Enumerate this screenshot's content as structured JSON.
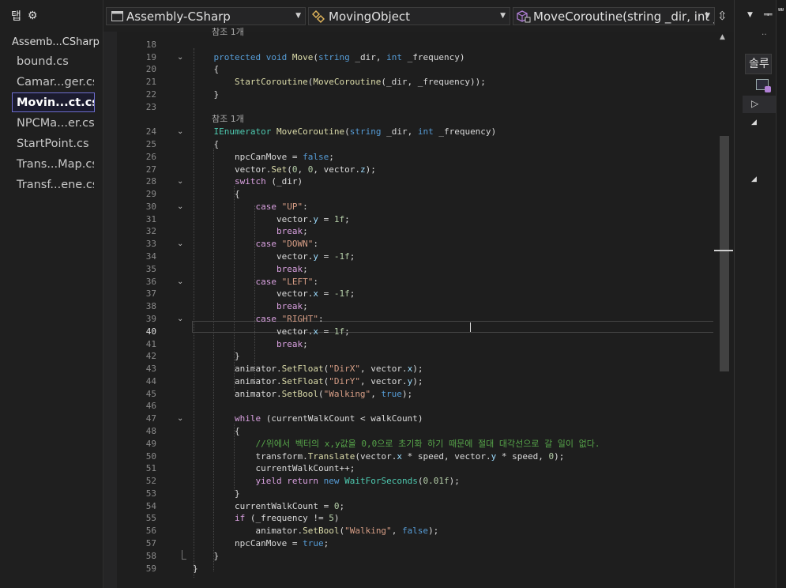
{
  "tab_panel": {
    "title": "탭",
    "settings_icon": "gear-icon",
    "project": "Assemb...CSharp",
    "files": [
      {
        "label": "bound.cs",
        "active": false
      },
      {
        "label": "Camar...ger.cs",
        "active": false
      },
      {
        "label": "Movin...ct.cs",
        "active": true
      },
      {
        "label": "NPCMa...er.cs",
        "active": false
      },
      {
        "label": "StartPoint.cs",
        "active": false
      },
      {
        "label": "Trans...Map.cs",
        "active": false
      },
      {
        "label": "Transf...ene.cs",
        "active": false
      }
    ]
  },
  "nav_bar": {
    "project": "Assembly-CSharp",
    "class": "MovingObject",
    "member": "MoveCoroutine(string _dir, int _"
  },
  "right_panel": {
    "tab_label": "솔루",
    "top_text": "ᄈ"
  },
  "codelens_text": "참조 1개",
  "current_line": 40,
  "lines": [
    {
      "n": 18,
      "lens": true,
      "code": []
    },
    {
      "n": 19,
      "fold": true,
      "code": [
        [
          "    ",
          ""
        ],
        [
          "protected",
          "kw"
        ],
        [
          " ",
          ""
        ],
        [
          "void",
          "kw"
        ],
        [
          " ",
          ""
        ],
        [
          "Move",
          "mt"
        ],
        [
          "(",
          ""
        ],
        [
          "string",
          "kw"
        ],
        [
          " ",
          ""
        ],
        [
          "_dir",
          "vr"
        ],
        [
          ", ",
          ""
        ],
        [
          "int",
          "kw"
        ],
        [
          " ",
          ""
        ],
        [
          "_frequency",
          "vr"
        ],
        [
          ")",
          ""
        ]
      ]
    },
    {
      "n": 20,
      "code": [
        [
          "    {",
          ""
        ]
      ]
    },
    {
      "n": 21,
      "code": [
        [
          "        ",
          ""
        ],
        [
          "StartCoroutine",
          "mt"
        ],
        [
          "(",
          ""
        ],
        [
          "MoveCoroutine",
          "mt"
        ],
        [
          "(",
          ""
        ],
        [
          "_dir",
          "vr"
        ],
        [
          ", ",
          ""
        ],
        [
          "_frequency",
          "vr"
        ],
        [
          "));",
          ""
        ]
      ]
    },
    {
      "n": 22,
      "code": [
        [
          "    }",
          ""
        ]
      ]
    },
    {
      "n": 23,
      "code": []
    },
    {
      "n": 24,
      "lens": true,
      "fold": true,
      "code": [
        [
          "    ",
          ""
        ],
        [
          "IEnumerator",
          "ty"
        ],
        [
          " ",
          ""
        ],
        [
          "MoveCoroutine",
          "mt"
        ],
        [
          "(",
          ""
        ],
        [
          "string",
          "kw"
        ],
        [
          " ",
          ""
        ],
        [
          "_dir",
          "vr"
        ],
        [
          ", ",
          ""
        ],
        [
          "int",
          "kw"
        ],
        [
          " ",
          ""
        ],
        [
          "_frequency",
          "vr"
        ],
        [
          ")",
          ""
        ]
      ]
    },
    {
      "n": 25,
      "code": [
        [
          "    {",
          ""
        ]
      ]
    },
    {
      "n": 26,
      "code": [
        [
          "        ",
          ""
        ],
        [
          "npcCanMove",
          "vr"
        ],
        [
          " = ",
          ""
        ],
        [
          "false",
          "kw"
        ],
        [
          ";",
          ""
        ]
      ]
    },
    {
      "n": 27,
      "code": [
        [
          "        ",
          ""
        ],
        [
          "vector",
          "vr"
        ],
        [
          ".",
          ""
        ],
        [
          "Set",
          "mt"
        ],
        [
          "(",
          ""
        ],
        [
          "0",
          "nu"
        ],
        [
          ", ",
          ""
        ],
        [
          "0",
          "nu"
        ],
        [
          ", ",
          ""
        ],
        [
          "vector",
          "vr"
        ],
        [
          ".",
          ""
        ],
        [
          "z",
          "pr"
        ],
        [
          ");",
          ""
        ]
      ]
    },
    {
      "n": 28,
      "fold": true,
      "code": [
        [
          "        ",
          ""
        ],
        [
          "switch",
          "fl"
        ],
        [
          " (",
          ""
        ],
        [
          "_dir",
          "vr"
        ],
        [
          ")",
          ""
        ]
      ]
    },
    {
      "n": 29,
      "code": [
        [
          "        {",
          ""
        ]
      ]
    },
    {
      "n": 30,
      "fold": true,
      "code": [
        [
          "            ",
          ""
        ],
        [
          "case",
          "fl"
        ],
        [
          " ",
          ""
        ],
        [
          "\"UP\"",
          "st"
        ],
        [
          ":",
          ""
        ]
      ]
    },
    {
      "n": 31,
      "code": [
        [
          "                ",
          ""
        ],
        [
          "vector",
          "vr"
        ],
        [
          ".",
          ""
        ],
        [
          "y",
          "pr"
        ],
        [
          " = ",
          ""
        ],
        [
          "1f",
          "nu"
        ],
        [
          ";",
          ""
        ]
      ]
    },
    {
      "n": 32,
      "code": [
        [
          "                ",
          ""
        ],
        [
          "break",
          "fl"
        ],
        [
          ";",
          ""
        ]
      ]
    },
    {
      "n": 33,
      "fold": true,
      "code": [
        [
          "            ",
          ""
        ],
        [
          "case",
          "fl"
        ],
        [
          " ",
          ""
        ],
        [
          "\"DOWN\"",
          "st"
        ],
        [
          ":",
          ""
        ]
      ]
    },
    {
      "n": 34,
      "code": [
        [
          "                ",
          ""
        ],
        [
          "vector",
          "vr"
        ],
        [
          ".",
          ""
        ],
        [
          "y",
          "pr"
        ],
        [
          " = ",
          ""
        ],
        [
          "-1f",
          "nu"
        ],
        [
          ";",
          ""
        ]
      ]
    },
    {
      "n": 35,
      "code": [
        [
          "                ",
          ""
        ],
        [
          "break",
          "fl"
        ],
        [
          ";",
          ""
        ]
      ]
    },
    {
      "n": 36,
      "fold": true,
      "code": [
        [
          "            ",
          ""
        ],
        [
          "case",
          "fl"
        ],
        [
          " ",
          ""
        ],
        [
          "\"LEFT\"",
          "st"
        ],
        [
          ":",
          ""
        ]
      ]
    },
    {
      "n": 37,
      "code": [
        [
          "                ",
          ""
        ],
        [
          "vector",
          "vr"
        ],
        [
          ".",
          ""
        ],
        [
          "x",
          "pr"
        ],
        [
          " = ",
          ""
        ],
        [
          "-1f",
          "nu"
        ],
        [
          ";",
          ""
        ]
      ]
    },
    {
      "n": 38,
      "code": [
        [
          "                ",
          ""
        ],
        [
          "break",
          "fl"
        ],
        [
          ";",
          ""
        ]
      ]
    },
    {
      "n": 39,
      "fold": true,
      "code": [
        [
          "            ",
          ""
        ],
        [
          "case",
          "fl"
        ],
        [
          " ",
          ""
        ],
        [
          "\"RIGHT\"",
          "st"
        ],
        [
          ":",
          ""
        ]
      ]
    },
    {
      "n": 40,
      "code": [
        [
          "                ",
          ""
        ],
        [
          "vector",
          "vr"
        ],
        [
          ".",
          ""
        ],
        [
          "x",
          "pr"
        ],
        [
          " = ",
          ""
        ],
        [
          "1f",
          "nu"
        ],
        [
          ";",
          ""
        ]
      ]
    },
    {
      "n": 41,
      "code": [
        [
          "                ",
          ""
        ],
        [
          "break",
          "fl"
        ],
        [
          ";",
          ""
        ]
      ]
    },
    {
      "n": 42,
      "code": [
        [
          "        }",
          ""
        ]
      ]
    },
    {
      "n": 43,
      "code": [
        [
          "        ",
          ""
        ],
        [
          "animator",
          "vr"
        ],
        [
          ".",
          ""
        ],
        [
          "SetFloat",
          "mt"
        ],
        [
          "(",
          ""
        ],
        [
          "\"DirX\"",
          "st"
        ],
        [
          ", ",
          ""
        ],
        [
          "vector",
          "vr"
        ],
        [
          ".",
          ""
        ],
        [
          "x",
          "pr"
        ],
        [
          ");",
          ""
        ]
      ]
    },
    {
      "n": 44,
      "code": [
        [
          "        ",
          ""
        ],
        [
          "animator",
          "vr"
        ],
        [
          ".",
          ""
        ],
        [
          "SetFloat",
          "mt"
        ],
        [
          "(",
          ""
        ],
        [
          "\"DirY\"",
          "st"
        ],
        [
          ", ",
          ""
        ],
        [
          "vector",
          "vr"
        ],
        [
          ".",
          ""
        ],
        [
          "y",
          "pr"
        ],
        [
          ");",
          ""
        ]
      ]
    },
    {
      "n": 45,
      "code": [
        [
          "        ",
          ""
        ],
        [
          "animator",
          "vr"
        ],
        [
          ".",
          ""
        ],
        [
          "SetBool",
          "mt"
        ],
        [
          "(",
          ""
        ],
        [
          "\"Walking\"",
          "st"
        ],
        [
          ", ",
          ""
        ],
        [
          "true",
          "kw"
        ],
        [
          ");",
          ""
        ]
      ]
    },
    {
      "n": 46,
      "code": []
    },
    {
      "n": 47,
      "fold": true,
      "code": [
        [
          "        ",
          ""
        ],
        [
          "while",
          "fl"
        ],
        [
          " (",
          ""
        ],
        [
          "currentWalkCount",
          "vr"
        ],
        [
          " < ",
          ""
        ],
        [
          "walkCount",
          "vr"
        ],
        [
          ")",
          ""
        ]
      ]
    },
    {
      "n": 48,
      "code": [
        [
          "        {",
          ""
        ]
      ]
    },
    {
      "n": 49,
      "code": [
        [
          "            ",
          ""
        ],
        [
          "//위에서 벡터의 x,y값을 0,0으로 초기화 하기 때문에 절대 대각선으로 갈 일이 없다.",
          "cm"
        ]
      ]
    },
    {
      "n": 50,
      "code": [
        [
          "            ",
          ""
        ],
        [
          "transform",
          "vr"
        ],
        [
          ".",
          ""
        ],
        [
          "Translate",
          "mt"
        ],
        [
          "(",
          ""
        ],
        [
          "vector",
          "vr"
        ],
        [
          ".",
          ""
        ],
        [
          "x",
          "pr"
        ],
        [
          " * ",
          ""
        ],
        [
          "speed",
          "vr"
        ],
        [
          ", ",
          ""
        ],
        [
          "vector",
          "vr"
        ],
        [
          ".",
          ""
        ],
        [
          "y",
          "pr"
        ],
        [
          " * ",
          ""
        ],
        [
          "speed",
          "vr"
        ],
        [
          ", ",
          ""
        ],
        [
          "0",
          "nu"
        ],
        [
          ");",
          ""
        ]
      ]
    },
    {
      "n": 51,
      "code": [
        [
          "            ",
          ""
        ],
        [
          "currentWalkCount",
          "vr"
        ],
        [
          "++;",
          ""
        ]
      ]
    },
    {
      "n": 52,
      "code": [
        [
          "            ",
          ""
        ],
        [
          "yield",
          "fl"
        ],
        [
          " ",
          ""
        ],
        [
          "return",
          "fl"
        ],
        [
          " ",
          ""
        ],
        [
          "new",
          "kw"
        ],
        [
          " ",
          ""
        ],
        [
          "WaitForSeconds",
          "ty"
        ],
        [
          "(",
          ""
        ],
        [
          "0.01f",
          "nu"
        ],
        [
          ");",
          ""
        ]
      ]
    },
    {
      "n": 53,
      "code": [
        [
          "        }",
          ""
        ]
      ]
    },
    {
      "n": 54,
      "code": [
        [
          "        ",
          ""
        ],
        [
          "currentWalkCount",
          "vr"
        ],
        [
          " = ",
          ""
        ],
        [
          "0",
          "nu"
        ],
        [
          ";",
          ""
        ]
      ]
    },
    {
      "n": 55,
      "code": [
        [
          "        ",
          ""
        ],
        [
          "if",
          "fl"
        ],
        [
          " (",
          ""
        ],
        [
          "_frequency",
          "vr"
        ],
        [
          " != ",
          ""
        ],
        [
          "5",
          "nu"
        ],
        [
          ")",
          ""
        ]
      ]
    },
    {
      "n": 56,
      "code": [
        [
          "            ",
          ""
        ],
        [
          "animator",
          "vr"
        ],
        [
          ".",
          ""
        ],
        [
          "SetBool",
          "mt"
        ],
        [
          "(",
          ""
        ],
        [
          "\"Walking\"",
          "st"
        ],
        [
          ", ",
          ""
        ],
        [
          "false",
          "kw"
        ],
        [
          ");",
          ""
        ]
      ]
    },
    {
      "n": 57,
      "code": [
        [
          "        ",
          ""
        ],
        [
          "npcCanMove",
          "vr"
        ],
        [
          " = ",
          ""
        ],
        [
          "true",
          "kw"
        ],
        [
          ";",
          ""
        ]
      ]
    },
    {
      "n": 58,
      "code": [
        [
          "    }",
          ""
        ]
      ]
    },
    {
      "n": 59,
      "code": [
        [
          "}",
          ""
        ]
      ]
    }
  ]
}
